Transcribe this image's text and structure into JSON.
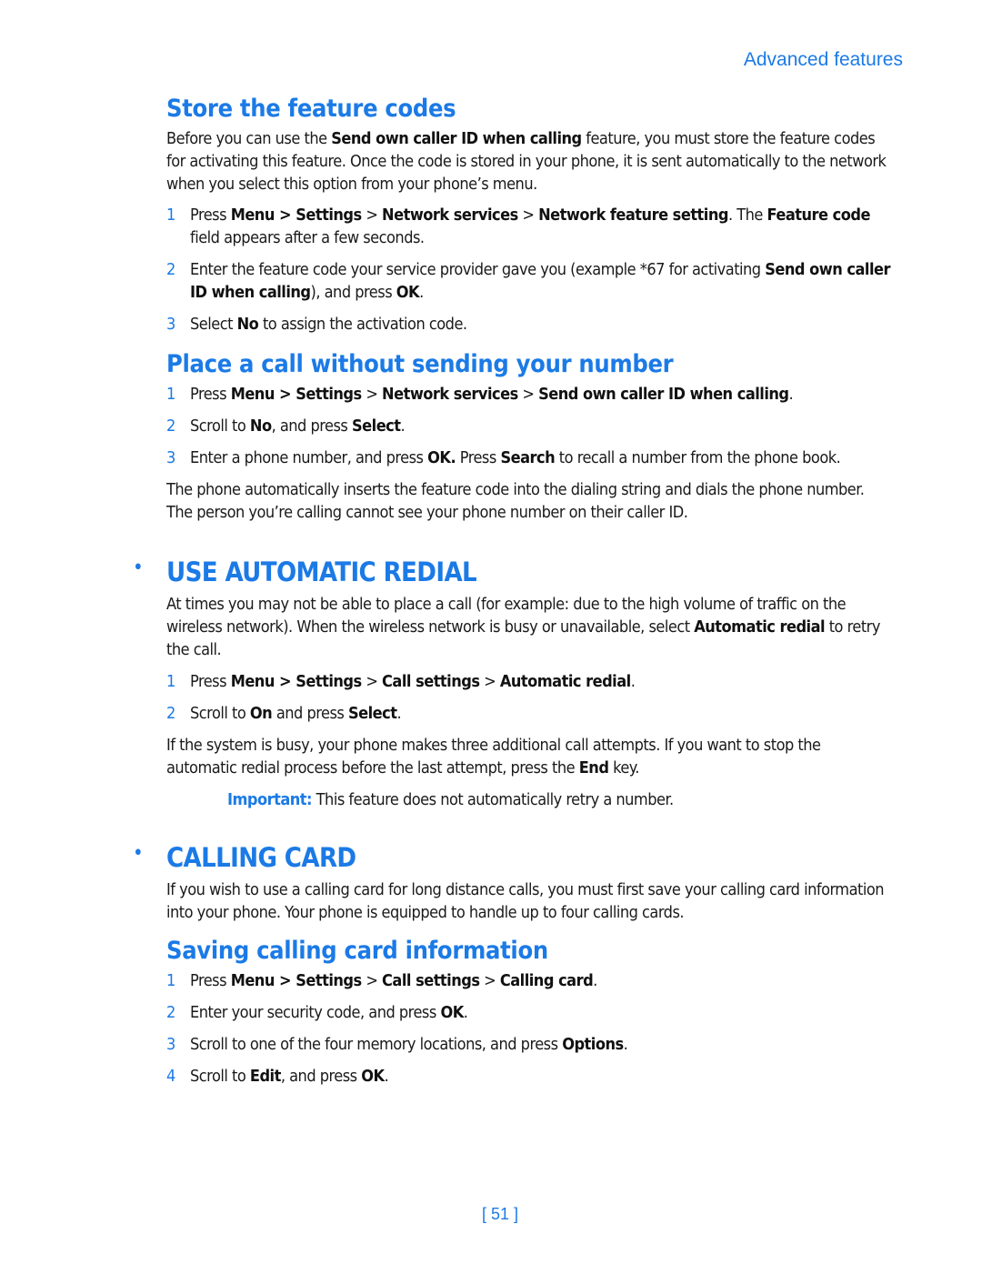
{
  "running_head": "Advanced features",
  "page_number": "[ 51 ]",
  "sections": {
    "store_codes": {
      "title": "Store the feature codes",
      "intro": [
        "Before you can use the ",
        "Send own caller ID when calling",
        " feature, you must store the feature codes for activating this feature. Once the code is stored in your phone, it is sent automatically to the network when you select this option from your phone’s menu."
      ],
      "steps": [
        {
          "n": "1",
          "parts": [
            "Press ",
            "Menu",
            " > ",
            "Settings",
            " > ",
            "Network services",
            " > ",
            "Network feature setting",
            ". The ",
            "Feature code",
            " field appears after a few seconds."
          ]
        },
        {
          "n": "2",
          "parts": [
            "Enter the feature code your service provider gave you (example *67  for activating ",
            "Send own caller ID when calling",
            "), and press ",
            "OK",
            "."
          ]
        },
        {
          "n": "3",
          "parts": [
            "Select ",
            "No",
            " to assign the activation code."
          ]
        }
      ]
    },
    "place_call": {
      "title": "Place a call without sending your number",
      "steps": [
        {
          "n": "1",
          "parts": [
            "Press ",
            "Menu",
            " > ",
            "Settings",
            " > ",
            "Network services",
            " > ",
            "Send own caller ID when calling",
            "."
          ]
        },
        {
          "n": "2",
          "parts": [
            "Scroll to ",
            "No",
            ", and press ",
            "Select",
            "."
          ]
        },
        {
          "n": "3",
          "parts": [
            "Enter a phone number, and press ",
            "OK.",
            " Press ",
            "Search",
            " to recall a number from the phone book."
          ]
        }
      ],
      "outro": "The phone automatically inserts the feature code into the dialing string and dials the phone number. The person you’re calling cannot see your phone number on their caller ID."
    },
    "auto_redial": {
      "bullet": "•",
      "title": "USE AUTOMATIC REDIAL",
      "intro": [
        "At times you may not be able to place a call (for example: due to the high volume of traffic on the wireless network). When the wireless network is busy or unavailable, select ",
        "Automatic redial",
        " to retry the call."
      ],
      "steps": [
        {
          "n": "1",
          "parts": [
            "Press ",
            "Menu",
            " > ",
            "Settings",
            " > ",
            "Call settings",
            " > ",
            "Automatic redial",
            "."
          ]
        },
        {
          "n": "2",
          "parts": [
            "Scroll to ",
            "On",
            " and press ",
            "Select",
            "."
          ]
        }
      ],
      "outro": [
        "If the system is busy, your phone makes three additional call attempts. If you want to stop the automatic redial process before the last attempt, press the ",
        "End",
        " key."
      ],
      "note_label": "Important:",
      "note_text": " This feature does not automatically retry a number."
    },
    "calling_card": {
      "bullet": "•",
      "title": "CALLING CARD",
      "intro": "If you wish to use a calling card for long distance calls, you must first save your calling card information into your phone. Your phone is equipped to handle up to four calling cards."
    },
    "saving_card": {
      "title": "Saving calling card information",
      "steps": [
        {
          "n": "1",
          "parts": [
            "Press ",
            "Menu",
            " > ",
            "Settings",
            " > ",
            "Call settings",
            " > ",
            "Calling card",
            "."
          ]
        },
        {
          "n": "2",
          "parts": [
            "Enter your security code, and press ",
            "OK",
            "."
          ]
        },
        {
          "n": "3",
          "parts": [
            "Scroll to one of the four memory locations, and press ",
            "Options",
            "."
          ]
        },
        {
          "n": "4",
          "parts": [
            "Scroll to ",
            "Edit",
            ", and press ",
            "OK",
            "."
          ]
        }
      ]
    }
  }
}
